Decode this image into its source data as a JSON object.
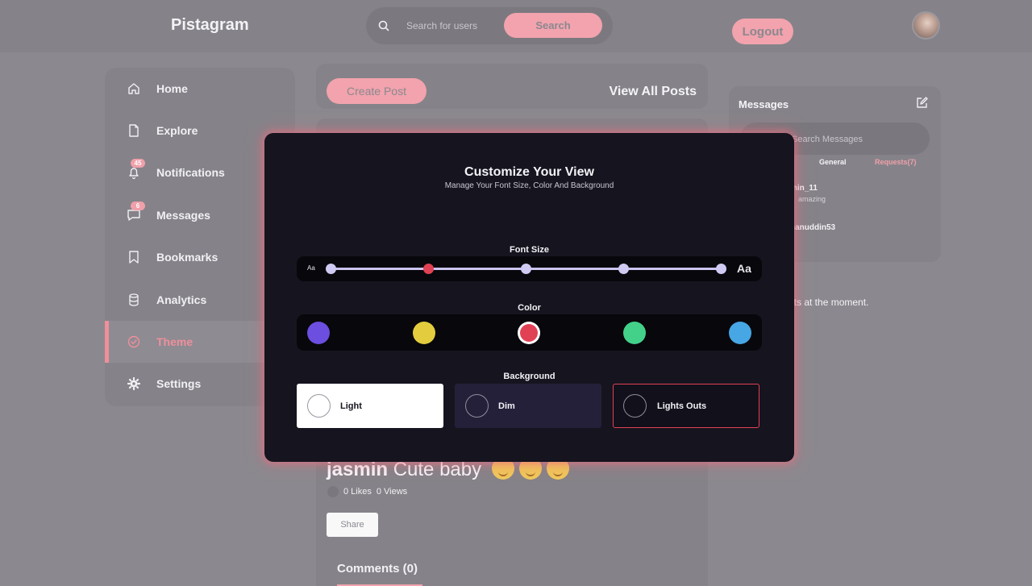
{
  "header": {
    "brand": "Pistagram",
    "search_placeholder": "Search for users",
    "search_button": "Search",
    "logout_button": "Logout",
    "avatar_icon": "user-avatar"
  },
  "sidebar": {
    "items": [
      {
        "label": "Home",
        "icon": "home-icon"
      },
      {
        "label": "Explore",
        "icon": "document-icon"
      },
      {
        "label": "Notifications",
        "icon": "bell-icon",
        "badge": "45"
      },
      {
        "label": "Messages",
        "icon": "chat-icon",
        "badge": "6"
      },
      {
        "label": "Bookmarks",
        "icon": "bookmark-icon"
      },
      {
        "label": "Analytics",
        "icon": "database-icon"
      },
      {
        "label": "Theme",
        "icon": "check-circle-icon",
        "active": true
      },
      {
        "label": "Settings",
        "icon": "gear-icon"
      }
    ]
  },
  "feed": {
    "create_post": "Create Post",
    "view_all": "View All Posts",
    "post": {
      "author": "jasmin",
      "caption": "Cute baby",
      "emojis": [
        "smiling-face",
        "smiling-face",
        "star-struck-face"
      ],
      "likes": "0 Likes",
      "views": "0 Views",
      "share": "Share"
    },
    "comments_title": "Comments (0)"
  },
  "messages": {
    "title": "Messages",
    "search_placeholder": "Search Messages",
    "tabs": [
      "General",
      "Requests(7)"
    ],
    "conversations": [
      {
        "name": "min_11",
        "preview": "amazing"
      },
      {
        "name": "hanuddin53",
        "preview": ""
      }
    ],
    "no_requests": "ests at the moment."
  },
  "modal": {
    "title": "Customize Your View",
    "subtitle": "Manage Your Font Size, Color And Background",
    "font_size_label": "Font Size",
    "font_small": "Aa",
    "font_large": "Aa",
    "font_size_steps": 5,
    "font_size_selected": 2,
    "color_label": "Color",
    "colors": [
      "#6c4ee0",
      "#e3cd3e",
      "#e14154",
      "#43d18a",
      "#47a6e4"
    ],
    "color_selected": 3,
    "background_label": "Background",
    "backgrounds": [
      "Light",
      "Dim",
      "Lights Outs"
    ],
    "background_selected": 3,
    "accent": "#e14154"
  }
}
